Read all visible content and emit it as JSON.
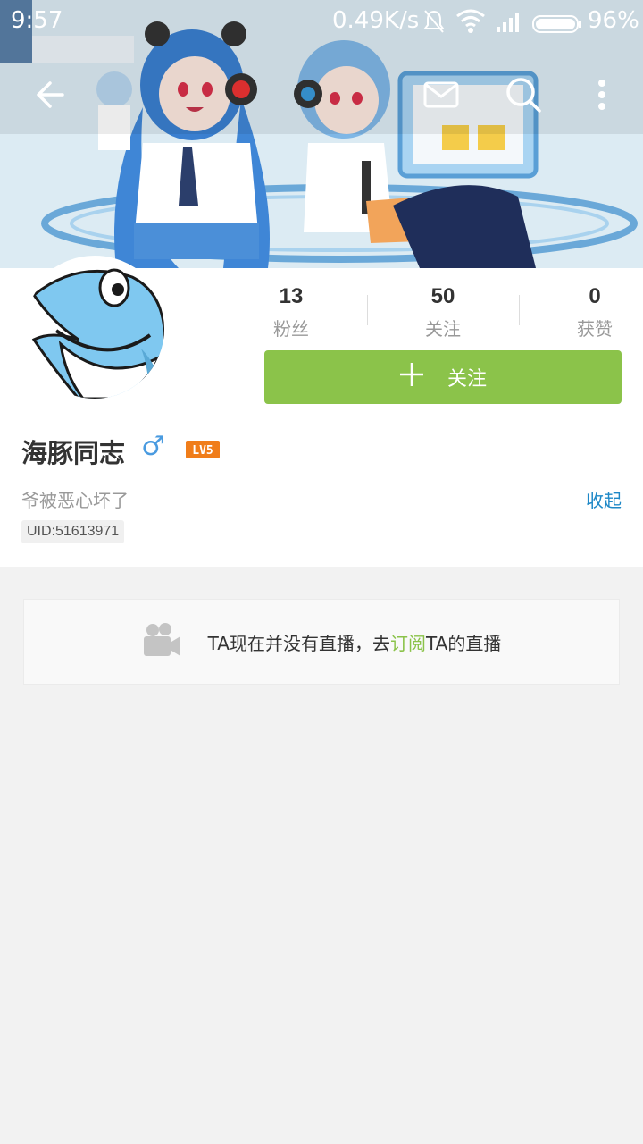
{
  "status_bar": {
    "time": "9:57",
    "network_speed": "0.49K/s",
    "battery": "96%"
  },
  "profile": {
    "stats": [
      {
        "value": "13",
        "label": "粉丝"
      },
      {
        "value": "50",
        "label": "关注"
      },
      {
        "value": "0",
        "label": "获赞"
      }
    ],
    "follow_label": "关注",
    "username": "海豚同志",
    "gender_symbol": "♂",
    "level": "LV5",
    "bio": "爷被恶心坏了",
    "collapse_label": "收起",
    "uid": "UID:51613971"
  },
  "live": {
    "text_before": "TA现在并没有直播，去",
    "link_text": "订阅",
    "text_after": "TA的直播"
  },
  "colors": {
    "accent_green": "#8bc34a",
    "link_blue": "#1e88c7",
    "level_orange": "#f07d1a"
  }
}
